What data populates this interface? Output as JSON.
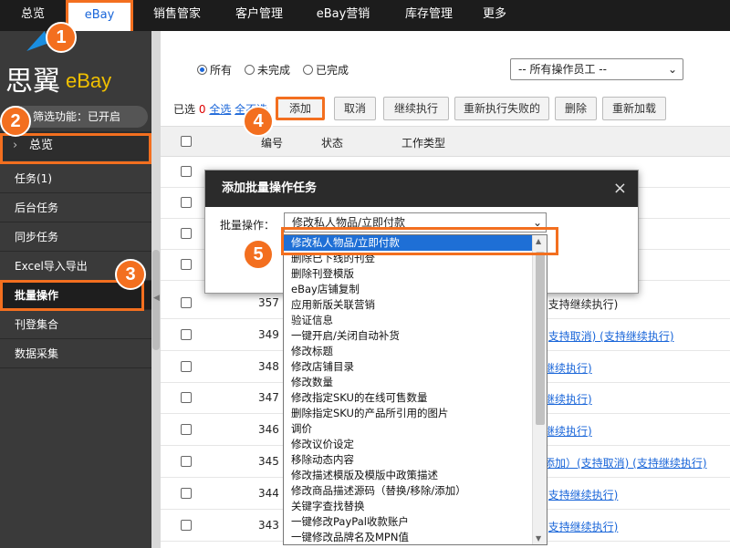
{
  "topnav": {
    "items": [
      {
        "label": "总览"
      },
      {
        "label": "eBay"
      },
      {
        "label": "销售管家"
      },
      {
        "label": "客户管理"
      },
      {
        "label": "eBay营销"
      },
      {
        "label": "库存管理"
      },
      {
        "label": "更多"
      }
    ]
  },
  "logo": {
    "brand": "思翼",
    "product": "eBay"
  },
  "sidebar": {
    "filter_status": "筛选功能：已开启",
    "overview": "总览",
    "items": [
      {
        "label": "任务(1)"
      },
      {
        "label": "后台任务"
      },
      {
        "label": "同步任务"
      },
      {
        "label": "Excel导入导出"
      },
      {
        "label": "批量操作"
      },
      {
        "label": "刊登集合"
      },
      {
        "label": "数据采集"
      }
    ]
  },
  "filter": {
    "radios": [
      {
        "label": "所有",
        "checked": true
      },
      {
        "label": "未完成",
        "checked": false
      },
      {
        "label": "已完成",
        "checked": false
      }
    ],
    "staff_select": "-- 所有操作员工 --"
  },
  "toolbar": {
    "selected_prefix": "已选",
    "selected_count": "0",
    "select_all": "全选",
    "select_all_2": "全不选",
    "buttons": [
      {
        "label": "添加"
      },
      {
        "label": "取消"
      },
      {
        "label": "继续执行"
      },
      {
        "label": "重新执行失败的"
      },
      {
        "label": "删除"
      },
      {
        "label": "重新加载"
      }
    ]
  },
  "table": {
    "headers": {
      "number": "编号",
      "status": "状态",
      "type": "工作类型"
    },
    "rows": [
      {
        "num": "",
        "desc": ""
      },
      {
        "num": "",
        "desc": ""
      },
      {
        "num": "",
        "desc": ""
      },
      {
        "num": "",
        "desc": ""
      },
      {
        "num": "357",
        "desc": "(支持继续执行)"
      },
      {
        "num": "349",
        "desc": "(支持取消) (支持继续执行)"
      },
      {
        "num": "348",
        "desc": "继续执行)"
      },
      {
        "num": "347",
        "desc": "继续执行)"
      },
      {
        "num": "346",
        "desc": "继续执行)"
      },
      {
        "num": "345",
        "desc": "添加）(支持取消) (支持继续执行)"
      },
      {
        "num": "344",
        "desc": "(支持继续执行)"
      },
      {
        "num": "343",
        "desc": "(支持继续执行)"
      }
    ]
  },
  "dialog": {
    "title": "添加批量操作任务",
    "close": "×",
    "label": "批量操作：",
    "selected": "修改私人物品/立即付款"
  },
  "dropdown": {
    "options": [
      "修改私人物品/立即付款",
      "删除已下线的刊登",
      "删除刊登模版",
      "eBay店铺复制",
      "应用新版关联营销",
      "验证信息",
      "一键开启/关闭自动补货",
      "修改标题",
      "修改店铺目录",
      "修改数量",
      "修改指定SKU的在线可售数量",
      "删除指定SKU的产品所引用的图片",
      "调价",
      "修改议价设定",
      "移除动态内容",
      "修改描述模版及模版中政策描述",
      "修改商品描述源码（替换/移除/添加）",
      "关键字查找替换",
      "一键修改PayPal收款账户",
      "一键修改品牌名及MPN值"
    ]
  },
  "badges": [
    "1",
    "2",
    "3",
    "4",
    "5"
  ],
  "colors": {
    "highlight": "#f36f1f",
    "link": "#1a66d9",
    "nav_bg": "#1c1c1c",
    "sidebar_bg": "#3a3a3a",
    "selected_option": "#1e6fd6"
  }
}
